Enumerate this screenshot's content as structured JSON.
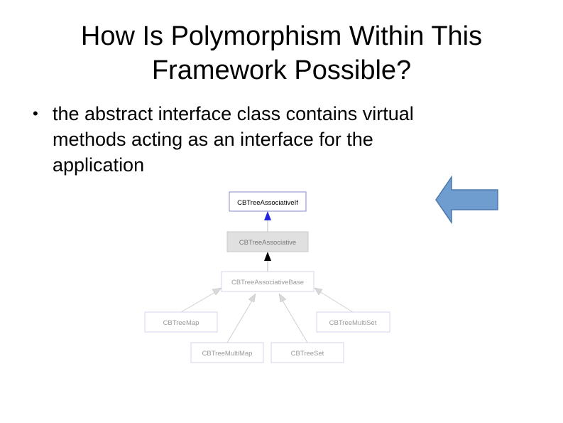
{
  "slide": {
    "title_line1": "How Is Polymorphism Within This",
    "title_line2": "Framework Possible?",
    "bullets": [
      {
        "line1": "the abstract interface class contains virtual",
        "line2": "methods acting as an interface for the",
        "line3": "application"
      }
    ]
  },
  "diagram": {
    "nodes": {
      "if": "CBTreeAssociativeIf",
      "assoc": "CBTreeAssociative",
      "base": "CBTreeAssociativeBase",
      "map": "CBTreeMap",
      "multimap": "CBTreeMultiMap",
      "set": "CBTreeSet",
      "multiset": "CBTreeMultiSet"
    }
  },
  "colors": {
    "arrow_fill": "#6f9dd0",
    "arrow_stroke": "#4a78ad",
    "box_border": "#cccced",
    "box_fill": "#ffffff",
    "assoc_fill": "#e0e0e0",
    "faded_text": "#999999"
  },
  "icons": {
    "nav_arrow": "left-arrow-icon",
    "bullet": "bullet-dot-icon"
  }
}
